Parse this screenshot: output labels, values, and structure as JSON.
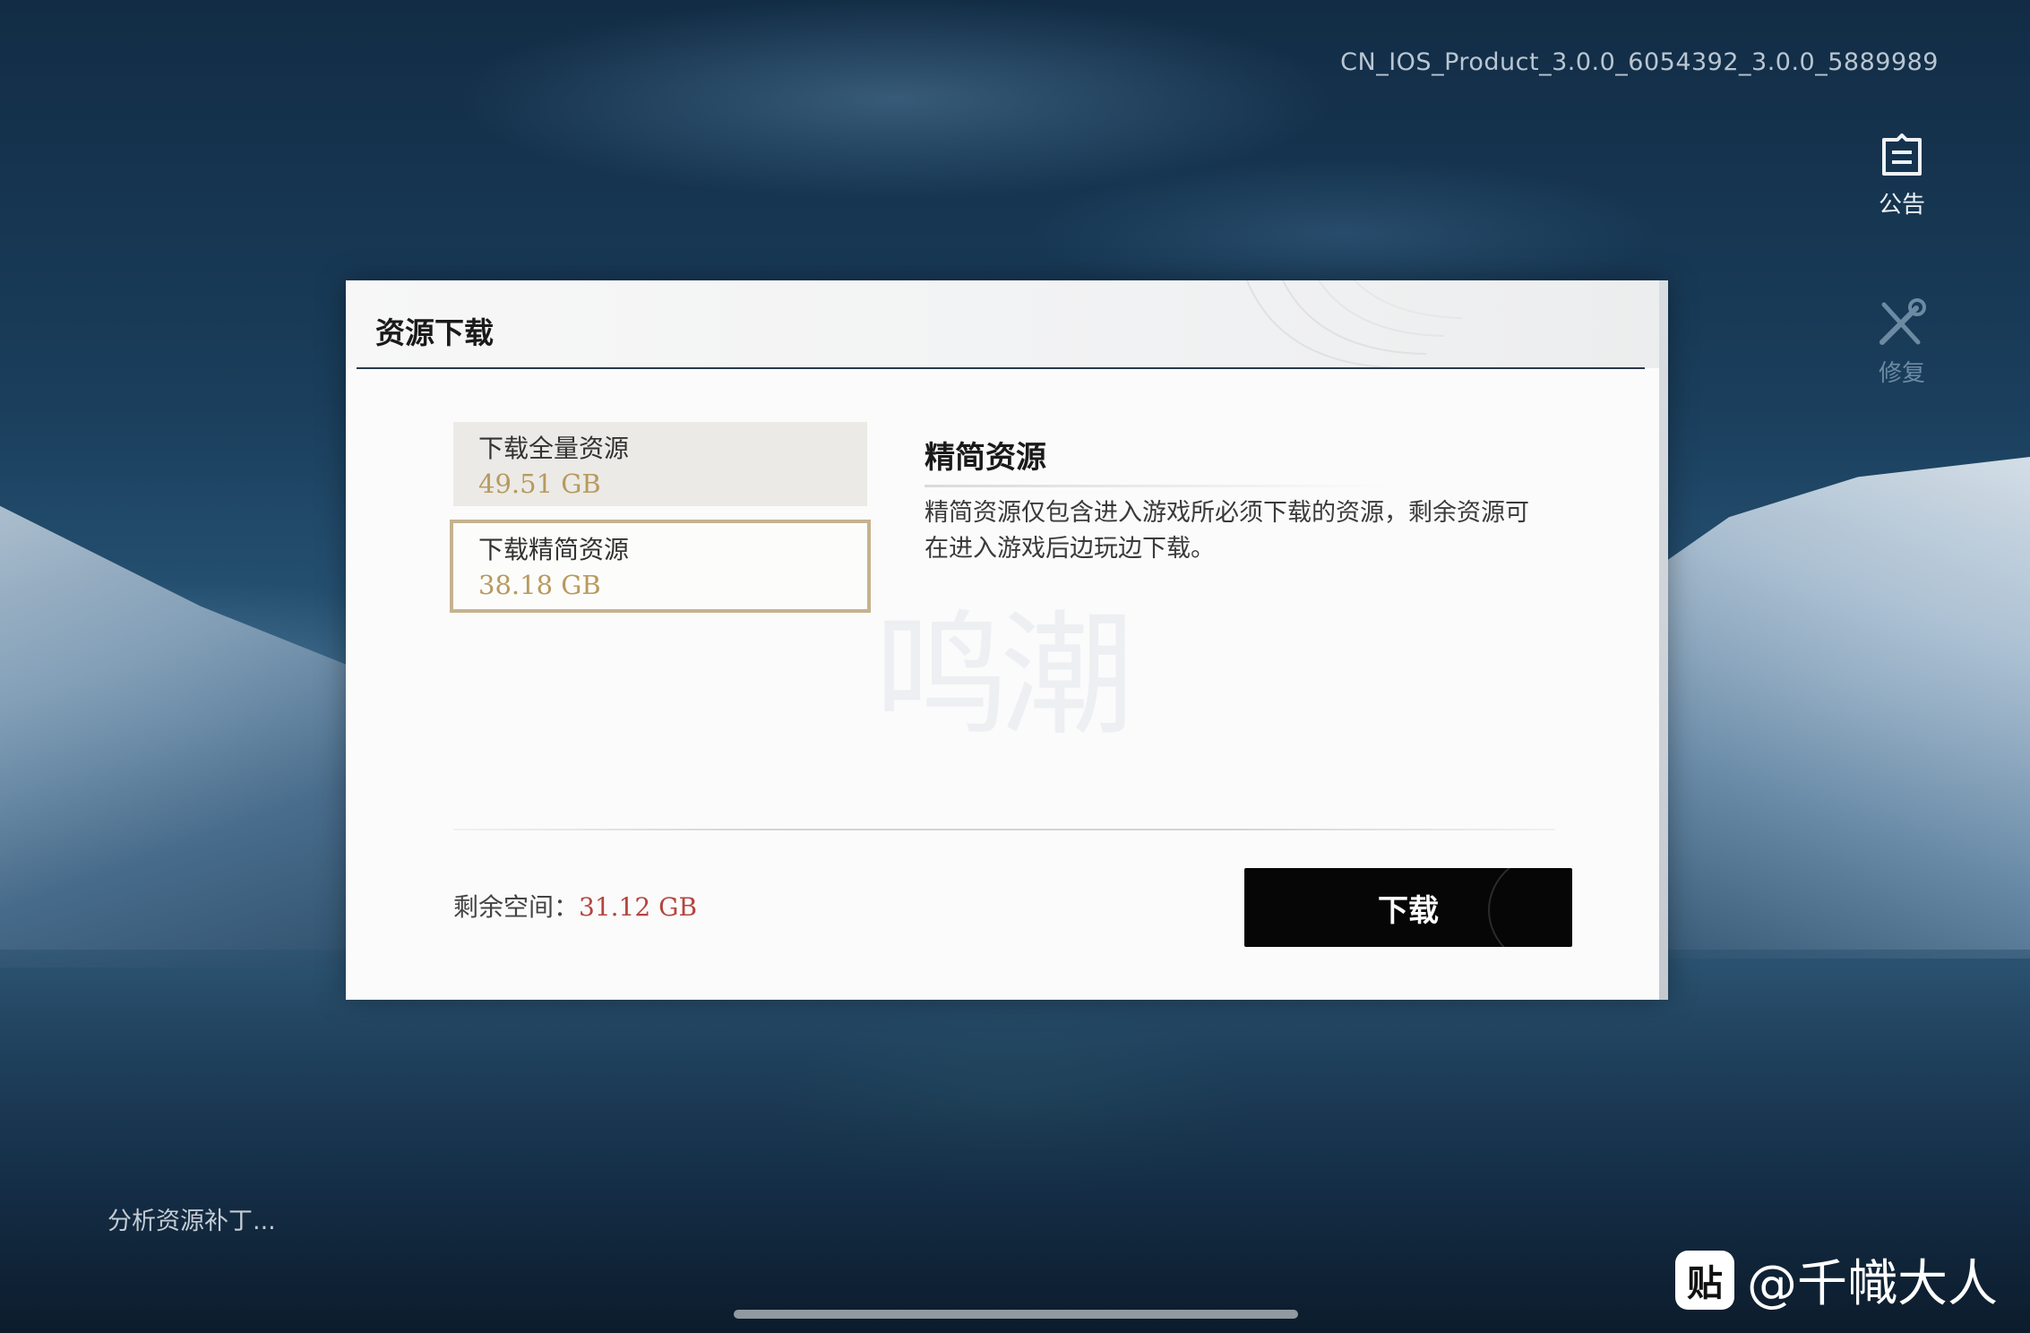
{
  "version_string": "CN_IOS_Product_3.0.0_6054392_3.0.0_5889989",
  "side_buttons": {
    "notice_label": "公告",
    "repair_label": "修复"
  },
  "dialog": {
    "title": "资源下载",
    "options": [
      {
        "label": "下载全量资源",
        "size": "49.51 GB",
        "selected": false
      },
      {
        "label": "下载精简资源",
        "size": "38.18 GB",
        "selected": true
      }
    ],
    "info_title": "精简资源",
    "info_description": "精简资源仅包含进入游戏所必须下载的资源，剩余资源可在进入游戏后边玩边下载。",
    "free_space_label": "剩余空间：",
    "free_space_value": "31.12 GB",
    "download_button": "下载",
    "watermark_text": "鸣潮"
  },
  "status_text": "分析资源补丁...",
  "brand": {
    "logo_glyph": "贴",
    "handle": "@千幟大人"
  },
  "colors": {
    "selected_border": "#c5b28f",
    "size_text": "#b89a5e",
    "free_space_value": "#b4453f",
    "download_button_bg": "#060606"
  }
}
